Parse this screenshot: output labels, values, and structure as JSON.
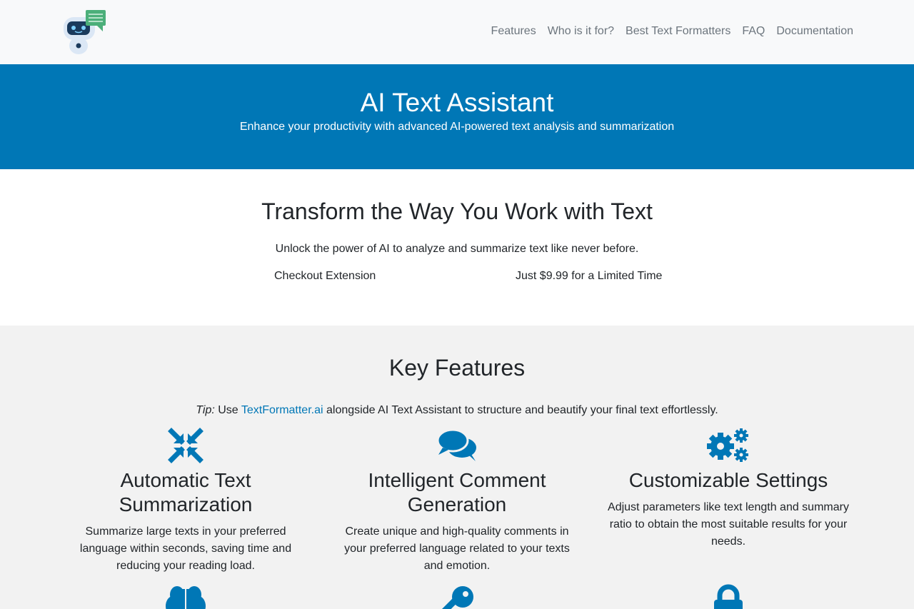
{
  "nav": {
    "links": [
      "Features",
      "Who is it for?",
      "Best Text Formatters",
      "FAQ",
      "Documentation"
    ]
  },
  "hero": {
    "title": "AI Text Assistant",
    "subtitle": "Enhance your productivity with advanced AI-powered text analysis and summarization"
  },
  "intro": {
    "title": "Transform the Way You Work with Text",
    "subtitle": "Unlock the power of AI to analyze and summarize text like never before.",
    "cta_left": "Checkout Extension",
    "cta_right": "Just $9.99 for a Limited Time"
  },
  "features": {
    "title": "Key Features",
    "tip_label": "Tip:",
    "tip_pre": " Use ",
    "tip_link": "TextFormatter.ai",
    "tip_post": " alongside AI Text Assistant to structure and beautify your final text effortlessly.",
    "items": [
      {
        "icon": "compress-arrows-icon",
        "title": "Automatic Text Summarization",
        "desc": "Summarize large texts in your preferred language within seconds, saving time and reducing your reading load."
      },
      {
        "icon": "comments-icon",
        "title": "Intelligent Comment Generation",
        "desc": "Create unique and high-quality comments in your preferred language related to your texts and emotion."
      },
      {
        "icon": "cogs-icon",
        "title": "Customizable Settings",
        "desc": "Adjust parameters like text length and summary ratio to obtain the most suitable results for your needs."
      },
      {
        "icon": "brain-icon"
      },
      {
        "icon": "key-icon"
      },
      {
        "icon": "lock-icon"
      }
    ]
  },
  "colors": {
    "accent": "#0077b6",
    "nav_bg": "#f8f9fa",
    "features_bg": "#f2f2f2",
    "logo_green": "#4caf7a"
  }
}
